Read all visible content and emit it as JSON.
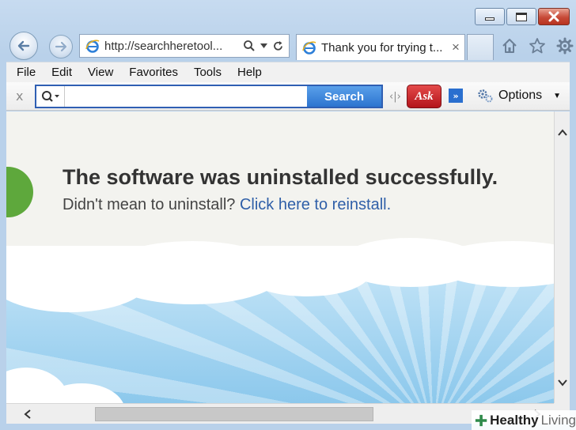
{
  "window": {
    "caption_buttons": [
      "minimize",
      "maximize",
      "close"
    ]
  },
  "navigation": {
    "address": "http://searchheretool...",
    "address_tools": [
      "search-icon",
      "dropdown-arrow",
      "refresh-icon"
    ],
    "tab_title": "Thank you for trying t...",
    "tab_close": "×",
    "right_icons": [
      "home-icon",
      "favorites-star-icon",
      "settings-gear-icon"
    ]
  },
  "menu": {
    "items": [
      {
        "label": "File"
      },
      {
        "label": "Edit"
      },
      {
        "label": "View"
      },
      {
        "label": "Favorites"
      },
      {
        "label": "Tools"
      },
      {
        "label": "Help"
      }
    ]
  },
  "ask_toolbar": {
    "close": "x",
    "search_value": "",
    "search_button": "Search",
    "logo": "Ask",
    "more": "»",
    "options_label": "Options",
    "options_caret": "▼",
    "colors": {
      "search_border": "#2f5fb3",
      "button": "#3d86dc",
      "logo": "#c81e24"
    }
  },
  "page": {
    "headline": "The software was uninstalled successfully.",
    "subline_prefix": "Didn't mean to uninstall?",
    "reinstall_link": "Click here to reinstall.",
    "colors": {
      "banner_bg": "#f3f3ef",
      "link": "#2f5fa8",
      "accent_green": "#5ea83c",
      "sky": "#a8d6f1"
    }
  },
  "watermark": {
    "bold": "Healthy",
    "light": "Living"
  }
}
